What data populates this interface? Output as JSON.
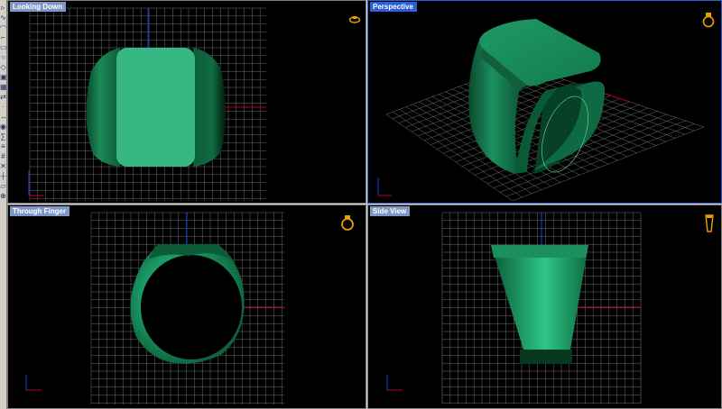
{
  "viewports": [
    {
      "label": "Looking Down",
      "view": "top",
      "active": false
    },
    {
      "label": "Perspective",
      "view": "perspective",
      "active": true
    },
    {
      "label": "Through Finger",
      "view": "front",
      "active": false
    },
    {
      "label": "Side View",
      "view": "side",
      "active": false
    }
  ],
  "toolbar": {
    "tools": [
      "select-tool",
      "curve-tool",
      "arc-tool",
      "polyline-tool",
      "rectangle-tool",
      "circle-tool",
      "surface-tool",
      "solid-tool",
      "mesh-tool",
      "transform-tool",
      "point-tool",
      "dimension-tool",
      "render-tool",
      "analyze-tool",
      "layer-tool",
      "grid-tool",
      "snap-tool",
      "ortho-tool",
      "planar-tool",
      "zoom-tool"
    ]
  },
  "icons": {
    "view_icon": "ring-view-icon",
    "axis": "axis-indicator-icon"
  },
  "colors": {
    "viewport_bg": "#000000",
    "grid_line": "#6e6e6e",
    "grid_major_red": "#b0001c",
    "grid_major_blue": "#1a3fd0",
    "ring_dark": "#0a4a2e",
    "ring_mid": "#178a58",
    "ring_light": "#3ac48a",
    "active_label": "#2a5fd8",
    "inactive_label": "#7f97c6"
  }
}
